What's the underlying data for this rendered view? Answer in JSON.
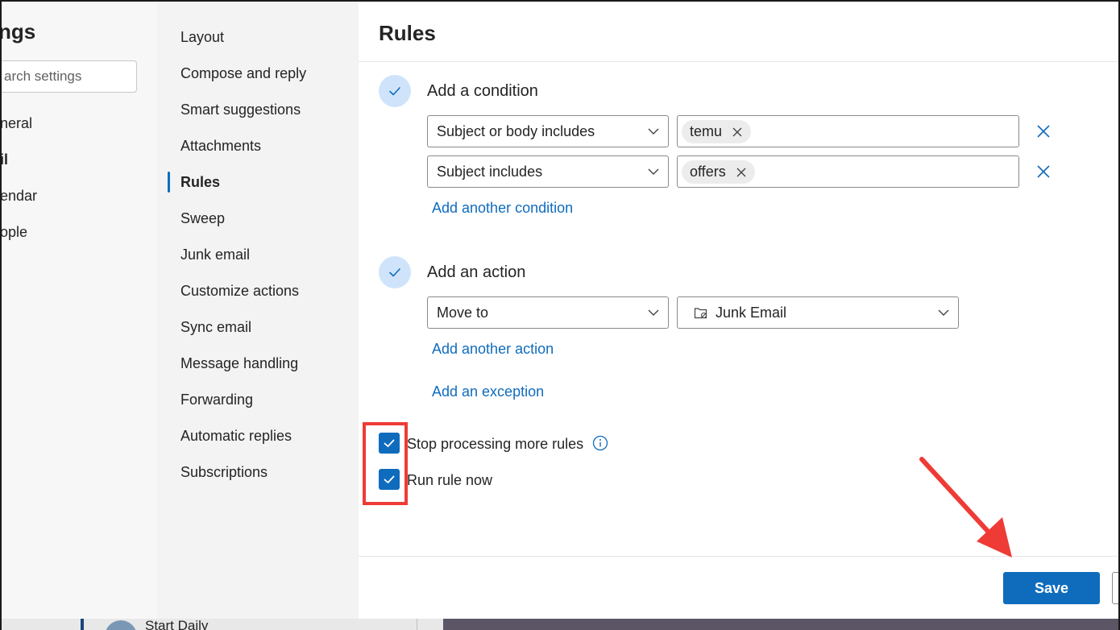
{
  "settings": {
    "title": "ngs",
    "search_placeholder": "arch settings",
    "categories": [
      {
        "label": "neral"
      },
      {
        "label": "il"
      },
      {
        "label": "endar"
      },
      {
        "label": "ople"
      }
    ]
  },
  "mail_nav": {
    "items": [
      {
        "label": "Layout"
      },
      {
        "label": "Compose and reply"
      },
      {
        "label": "Smart suggestions"
      },
      {
        "label": "Attachments"
      },
      {
        "label": "Rules"
      },
      {
        "label": "Sweep"
      },
      {
        "label": "Junk email"
      },
      {
        "label": "Customize actions"
      },
      {
        "label": "Sync email"
      },
      {
        "label": "Message handling"
      },
      {
        "label": "Forwarding"
      },
      {
        "label": "Automatic replies"
      },
      {
        "label": "Subscriptions"
      }
    ],
    "active": "Rules"
  },
  "rules": {
    "title": "Rules",
    "condition_step": {
      "label": "Add a condition",
      "rows": [
        {
          "field": "Subject or body includes",
          "chip": "temu"
        },
        {
          "field": "Subject includes",
          "chip": "offers"
        }
      ],
      "add_link": "Add another condition"
    },
    "action_step": {
      "label": "Add an action",
      "action": "Move to",
      "folder": "Junk Email",
      "add_link": "Add another action"
    },
    "exception_link": "Add an exception",
    "options": [
      {
        "label": "Stop processing more rules",
        "checked": true
      },
      {
        "label": "Run rule now",
        "checked": true
      }
    ],
    "save_label": "Save"
  },
  "taskbar": {
    "item_label": "Start Daily"
  },
  "colors": {
    "accent": "#0f6cbd",
    "annotation": "#ef3b36"
  }
}
